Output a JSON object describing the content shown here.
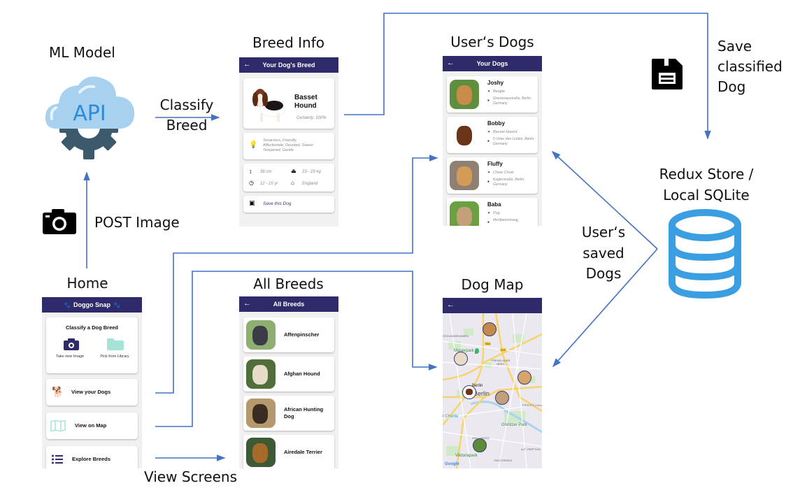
{
  "diagram": {
    "title_ml_model": "ML Model",
    "title_breed_info": "Breed Info",
    "title_users_dogs": "User‘s Dogs",
    "title_home": "Home",
    "title_all_breeds": "All Breeds",
    "title_dog_map": "Dog Map",
    "title_store_line1": "Redux Store /",
    "title_store_line2": "Local SQLite",
    "edge_classify_line1": "Classify",
    "edge_classify_line2": "Breed",
    "edge_post_image": "POST Image",
    "edge_save_line1": "Save",
    "edge_save_line2": "classified",
    "edge_save_line3": "Dog",
    "edge_saved_line1": "User‘s",
    "edge_saved_line2": "saved",
    "edge_saved_line3": "Dogs",
    "edge_view_screens": "View Screens",
    "api_text": "API",
    "arrow_color": "#4472c4"
  },
  "breed_info_screen": {
    "appbar_title": "Your Dog's Breed",
    "back_icon": "←",
    "breed_name_line1": "Basset",
    "breed_name_line2": "Hound",
    "certainty": "Certainty: 100%",
    "temperament": "Tenacious, Friendly, Affectionate, Devoted, Sweet-Tempered, Gentle",
    "height": "36 cm",
    "weight": "23 - 29 kg",
    "lifespan": "12 - 15 yr",
    "origin": "England",
    "save_label": "Save this Dog"
  },
  "users_dogs_screen": {
    "appbar_title": "Your Dogs",
    "back_icon": "←",
    "dogs": [
      {
        "name": "Joshy",
        "breed": "Beagle",
        "location": "Gneisenaustraße, Berlin, Germany"
      },
      {
        "name": "Bobby",
        "breed": "Basset Hound",
        "location": "5 Unter den Linden, Berlin, Germany"
      },
      {
        "name": "Fluffy",
        "breed": "Chow Chow",
        "location": "Kuglerstraße, Berlin, Germany"
      },
      {
        "name": "Baba",
        "breed": "Pug",
        "location": "Mehlbeerenweg,"
      }
    ]
  },
  "home_screen": {
    "appbar_title": "Doggo Snap",
    "classify_title": "Classify a Dog Breed",
    "take_image_label": "Take new Image",
    "pick_library_label": "Pick from Library",
    "view_dogs_label": "View your Dogs",
    "view_map_label": "View on Map",
    "explore_breeds_label": "Explore Breeds"
  },
  "all_breeds_screen": {
    "appbar_title": "All Breeds",
    "back_icon": "←",
    "breeds": [
      {
        "name": "Affenpinscher"
      },
      {
        "name": "Afghan Hound"
      },
      {
        "name": "African Hunting Dog"
      },
      {
        "name": "Airedale Terrier"
      }
    ]
  },
  "dog_map_screen": {
    "back_icon": "←",
    "labels": {
      "gesundbrunnen": "GESUNDBRUNNEN",
      "mauerpark": "Mauerpark",
      "prenzlauer": "PRENZLAUER BERG",
      "berlin_small": "Berlin",
      "berlin_big": "Berlin",
      "friedrichshain": "FRIEDRICHSHAIN",
      "charlie": "t Charlie",
      "goerlitzer": "Görlitzer Park",
      "kreuzberg": "KREUZBERG",
      "alt_treptow": "ALT-TREPTOW",
      "viktoriapark": "Viktoriapark",
      "reuterkiez": "REUTERKIEZ",
      "road_96a": "96a",
      "road_109": "109",
      "google": "Google"
    }
  }
}
